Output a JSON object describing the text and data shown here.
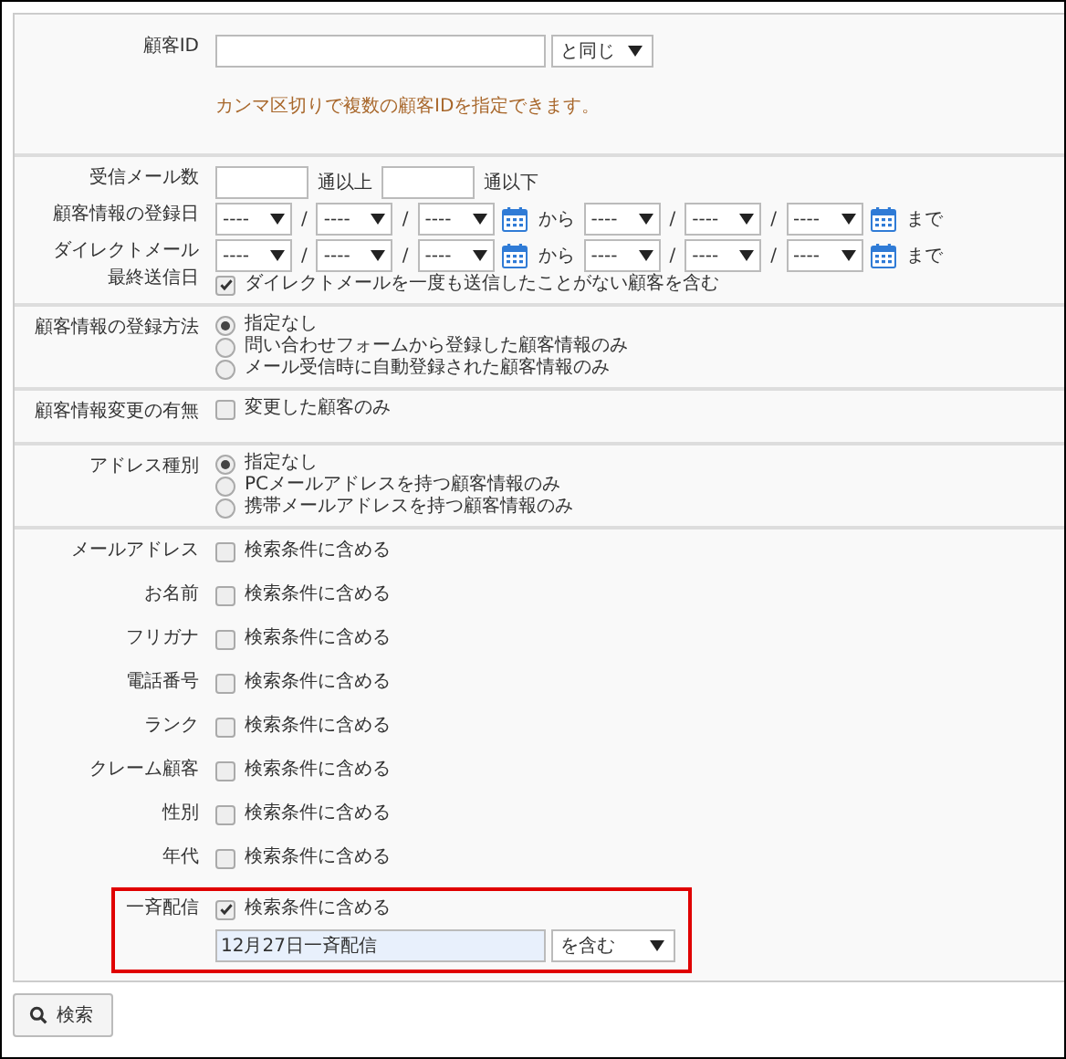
{
  "sections": [
    {
      "rows": [
        {
          "kind": "id",
          "label": "顧客ID",
          "value": "",
          "select": "と同じ",
          "hint": "カンマ区切りで複数の顧客IDを指定できます。"
        }
      ]
    },
    {
      "rows": [
        {
          "kind": "count",
          "label": "受信メール数",
          "min_unit": "通以上",
          "max_unit": "通以下"
        },
        {
          "kind": "daterange",
          "label_lines": [
            "顧客情報の登録日"
          ],
          "start": {
            "selects": [
              "----",
              "----",
              "----"
            ],
            "separators": [
              "/",
              "/"
            ]
          },
          "from_word": "から",
          "end": {
            "selects": [
              "----",
              "----",
              "----"
            ],
            "separators": [
              "/",
              "/"
            ]
          },
          "to_word": "まで"
        },
        {
          "kind": "daterange",
          "label_lines": [
            "ダイレクトメール",
            "最終送信日"
          ],
          "start": {
            "selects": [
              "----",
              "----",
              "----"
            ],
            "separators": [
              "/",
              "/"
            ]
          },
          "from_word": "から",
          "end": {
            "selects": [
              "----",
              "----",
              "----"
            ],
            "separators": [
              "/",
              "/"
            ]
          },
          "to_word": "まで",
          "option": {
            "label": "ダイレクトメールを一度も送信したことがない顧客を含む",
            "checked": true
          }
        }
      ]
    },
    {
      "rows": [
        {
          "kind": "radio",
          "label": "顧客情報の登録方法",
          "options": [
            {
              "label": "指定なし",
              "selected": true
            },
            {
              "label": "問い合わせフォームから登録した顧客情報のみ",
              "selected": false
            },
            {
              "label": "メール受信時に自動登録された顧客情報のみ",
              "selected": false
            }
          ]
        }
      ]
    },
    {
      "rows": [
        {
          "kind": "checkbox",
          "label": "顧客情報変更の有無",
          "option": {
            "label": "変更した顧客のみ",
            "checked": false
          }
        }
      ]
    },
    {
      "rows": [
        {
          "kind": "radio",
          "label": "アドレス種別",
          "options": [
            {
              "label": "指定なし",
              "selected": true
            },
            {
              "label": "PCメールアドレスを持つ顧客情報のみ",
              "selected": false
            },
            {
              "label": "携帯メールアドレスを持つ顧客情報のみ",
              "selected": false
            }
          ]
        }
      ]
    },
    {
      "rows": [
        {
          "kind": "checkbox",
          "label": "メールアドレス",
          "option": {
            "label": "検索条件に含める",
            "checked": false
          }
        },
        {
          "kind": "checkbox",
          "label": "お名前",
          "option": {
            "label": "検索条件に含める",
            "checked": false
          }
        },
        {
          "kind": "checkbox",
          "label": "フリガナ",
          "option": {
            "label": "検索条件に含める",
            "checked": false
          }
        },
        {
          "kind": "checkbox",
          "label": "電話番号",
          "option": {
            "label": "検索条件に含める",
            "checked": false
          }
        },
        {
          "kind": "checkbox",
          "label": "ランク",
          "option": {
            "label": "検索条件に含める",
            "checked": false
          }
        },
        {
          "kind": "checkbox",
          "label": "クレーム顧客",
          "option": {
            "label": "検索条件に含める",
            "checked": false
          }
        },
        {
          "kind": "checkbox",
          "label": "性別",
          "option": {
            "label": "検索条件に含める",
            "checked": false
          }
        },
        {
          "kind": "checkbox",
          "label": "年代",
          "option": {
            "label": "検索条件に含める",
            "checked": false
          }
        },
        {
          "kind": "checkbox",
          "label": "一斉配信",
          "highlighted": true,
          "option": {
            "label": "検索条件に含める",
            "checked": true
          },
          "text_field": {
            "value": "12月27日一斉配信"
          },
          "select": "を含む"
        }
      ]
    }
  ],
  "search_button": {
    "label": "検索"
  }
}
